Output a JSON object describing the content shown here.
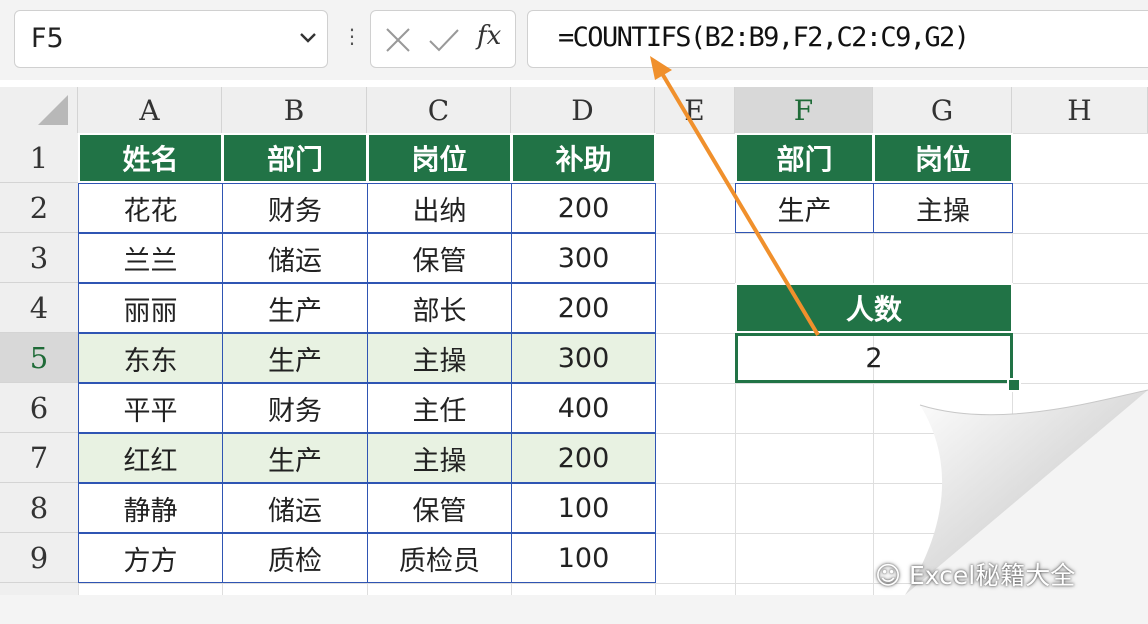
{
  "name_box": "F5",
  "formula_bar": {
    "cancel_icon": "close-icon",
    "enter_icon": "check-icon",
    "fx_label": "fx",
    "formula": "=COUNTIFS(B2:B9,F2,C2:C9,G2)"
  },
  "columns": [
    "A",
    "B",
    "C",
    "D",
    "E",
    "F",
    "G",
    "H"
  ],
  "rows": [
    "1",
    "2",
    "3",
    "4",
    "5",
    "6",
    "7",
    "8",
    "9"
  ],
  "table": {
    "headers": [
      "姓名",
      "部门",
      "岗位",
      "补助"
    ],
    "rows": [
      [
        "花花",
        "财务",
        "出纳",
        "200"
      ],
      [
        "兰兰",
        "储运",
        "保管",
        "300"
      ],
      [
        "丽丽",
        "生产",
        "部长",
        "200"
      ],
      [
        "东东",
        "生产",
        "主操",
        "300"
      ],
      [
        "平平",
        "财务",
        "主任",
        "400"
      ],
      [
        "红红",
        "生产",
        "主操",
        "200"
      ],
      [
        "静静",
        "储运",
        "保管",
        "100"
      ],
      [
        "方方",
        "质检",
        "质检员",
        "100"
      ]
    ],
    "highlight_rows": [
      3,
      5
    ],
    "highlight_color": "#e8f2e2"
  },
  "criteria": {
    "headers": [
      "部门",
      "岗位"
    ],
    "values": [
      "生产",
      "主操"
    ]
  },
  "result": {
    "header": "人数",
    "value": "2"
  },
  "watermark": "Excel秘籍大全",
  "colors": {
    "header_green": "#217346",
    "border_blue": "#2f55b3",
    "arrow": "#f0902c"
  }
}
